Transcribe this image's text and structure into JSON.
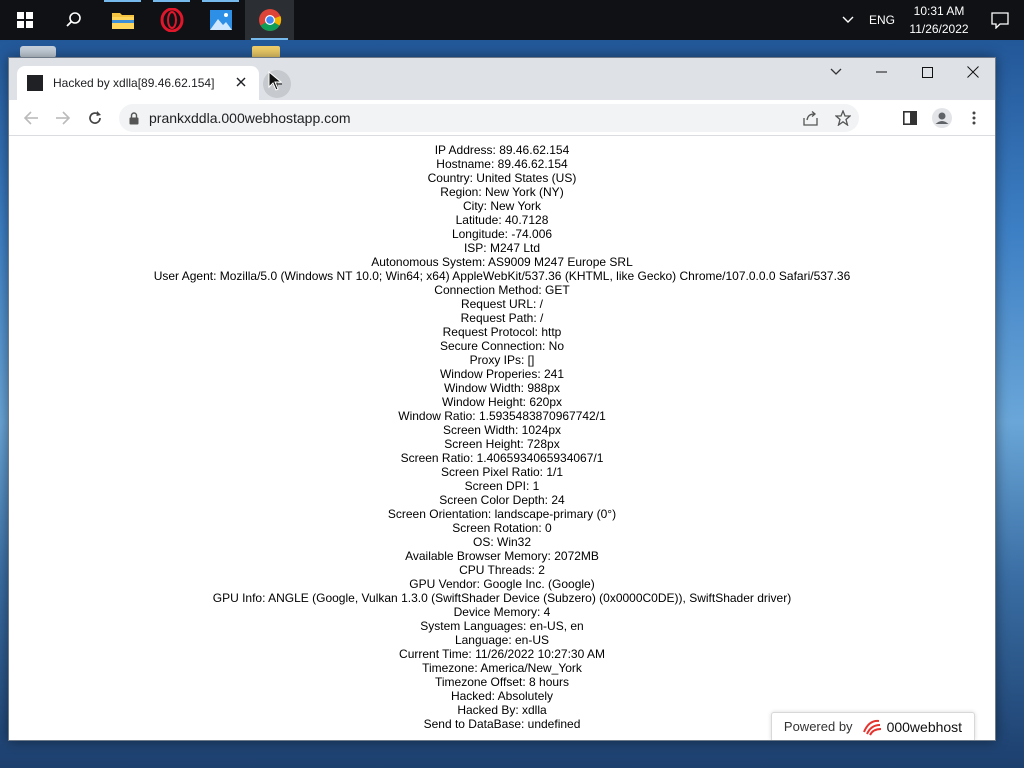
{
  "taskbar": {
    "apps": [
      {
        "name": "file-explorer"
      },
      {
        "name": "opera"
      },
      {
        "name": "photos"
      },
      {
        "name": "chrome"
      }
    ],
    "tray": {
      "language": "ENG",
      "time": "10:31 AM",
      "date": "11/26/2022"
    }
  },
  "browser": {
    "tab_title": "Hacked by xdlla[89.46.62.154]",
    "url": "prankxddla.000webhostapp.com"
  },
  "page": {
    "lines": [
      "IP Address: 89.46.62.154",
      "Hostname: 89.46.62.154",
      "Country: United States (US)",
      "Region: New York (NY)",
      "City: New York",
      "Latitude: 40.7128",
      "Longitude: -74.006",
      "ISP: M247 Ltd",
      "Autonomous System: AS9009 M247 Europe SRL",
      "User Agent: Mozilla/5.0 (Windows NT 10.0; Win64; x64) AppleWebKit/537.36 (KHTML, like Gecko) Chrome/107.0.0.0 Safari/537.36",
      "Connection Method: GET",
      "Request URL: /",
      "Request Path: /",
      "Request Protocol: http",
      "Secure Connection: No",
      "Proxy IPs: []",
      "Window Properies: 241",
      "Window Width: 988px",
      "Window Height: 620px",
      "Window Ratio: 1.5935483870967742/1",
      "Screen Width: 1024px",
      "Screen Height: 728px",
      "Screen Ratio: 1.4065934065934067/1",
      "Screen Pixel Ratio: 1/1",
      "Screen DPI: 1",
      "Screen Color Depth: 24",
      "Screen Orientation: landscape-primary (0°)",
      "Screen Rotation: 0",
      "OS: Win32",
      "Available Browser Memory: 2072MB",
      "CPU Threads: 2",
      "GPU Vendor: Google Inc. (Google)",
      "GPU Info: ANGLE (Google, Vulkan 1.3.0 (SwiftShader Device (Subzero) (0x0000C0DE)), SwiftShader driver)",
      "Device Memory: 4",
      "System Languages: en-US, en",
      "Language: en-US",
      "Current Time: 11/26/2022 10:27:30 AM",
      "Timezone: America/New_York",
      "Timezone Offset: 8 hours",
      "Hacked: Absolutely",
      "Hacked By: xdlla",
      "Send to DataBase: undefined"
    ],
    "powered_by_label": "Powered by",
    "powered_by_brand": "000webhost"
  }
}
